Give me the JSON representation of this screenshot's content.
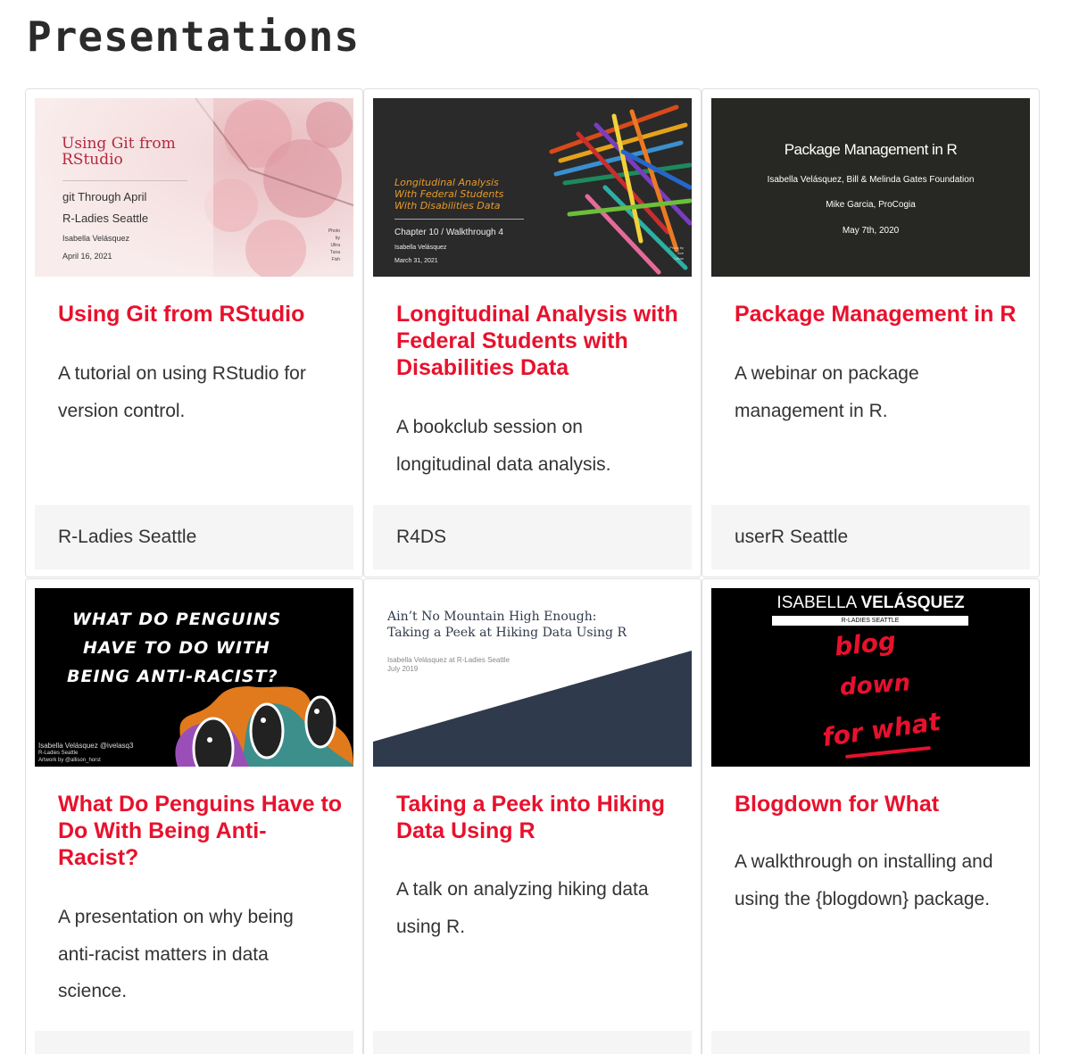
{
  "page": {
    "title": "Presentations"
  },
  "cards": [
    {
      "title": "Using Git from RStudio",
      "description": "A tutorial on using RStudio for version control.",
      "footer": "R-Ladies Seattle",
      "thumb": {
        "title": "Using Git from RStudio",
        "line1": "git Through April",
        "line2": "R-Ladies Seattle",
        "author": "Isabella Velásquez",
        "date": "April 16, 2021",
        "credit": "Photo by Ultra Tuna Fish"
      }
    },
    {
      "title": "Longitudinal Analysis with Federal Students with Disabilities Data",
      "description": "A bookclub session on longitudinal data analysis.",
      "footer": "R4DS",
      "thumb": {
        "title1": "Longitudinal Analysis",
        "title2": "With Federal Students",
        "title3": "With Disabilities Data",
        "chapter": "Chapter 10 / Walkthrough 4",
        "author": "Isabella Velásquez",
        "date": "March 31, 2021",
        "credit": "Photo by Ave Calvar"
      }
    },
    {
      "title": "Package Management in R",
      "description": "A webinar on package management in R.",
      "footer": "userR Seattle",
      "thumb": {
        "title": "Package Management in R",
        "line1": "Isabella Velásquez, Bill & Melinda Gates Foundation",
        "line2": "Mike Garcia, ProCogia",
        "date": "May 7th, 2020"
      }
    },
    {
      "title": "What Do Penguins Have to Do With Being Anti-Racist?",
      "description": "A presentation on why being anti-racist matters in data science.",
      "footer": "",
      "thumb": {
        "line1": "WHAT DO PENGUINS",
        "line2": "HAVE TO DO WITH",
        "line3": "BEING ANTI-RACIST?",
        "author": "Isabella Velásquez @ivelasq3",
        "org": "R-Ladies Seattle",
        "credit": "Artwork by @allison_horst"
      }
    },
    {
      "title": "Taking a Peek into Hiking Data Using R",
      "description": "A talk on analyzing hiking data using R.",
      "footer": "",
      "thumb": {
        "title1": "Ain’t No Mountain High Enough:",
        "title2": "Taking a Peek at Hiking Data Using R",
        "author": "Isabella Velásquez at R-Ladies Seattle",
        "date": "July 2019"
      }
    },
    {
      "title": "Blogdown for What",
      "description": "A walkthrough on installing and using the {blogdown} package.",
      "footer": "",
      "thumb": {
        "name1": "ISABELLA",
        "name2": "VELÁSQUEZ",
        "org": "R-LADIES SEATTLE",
        "w1": "blog",
        "w2": "down",
        "w3": "for what"
      }
    }
  ],
  "colors": {
    "accent": "#e8112d",
    "footer_bg": "#f5f5f5",
    "border": "#e0e0e0"
  }
}
